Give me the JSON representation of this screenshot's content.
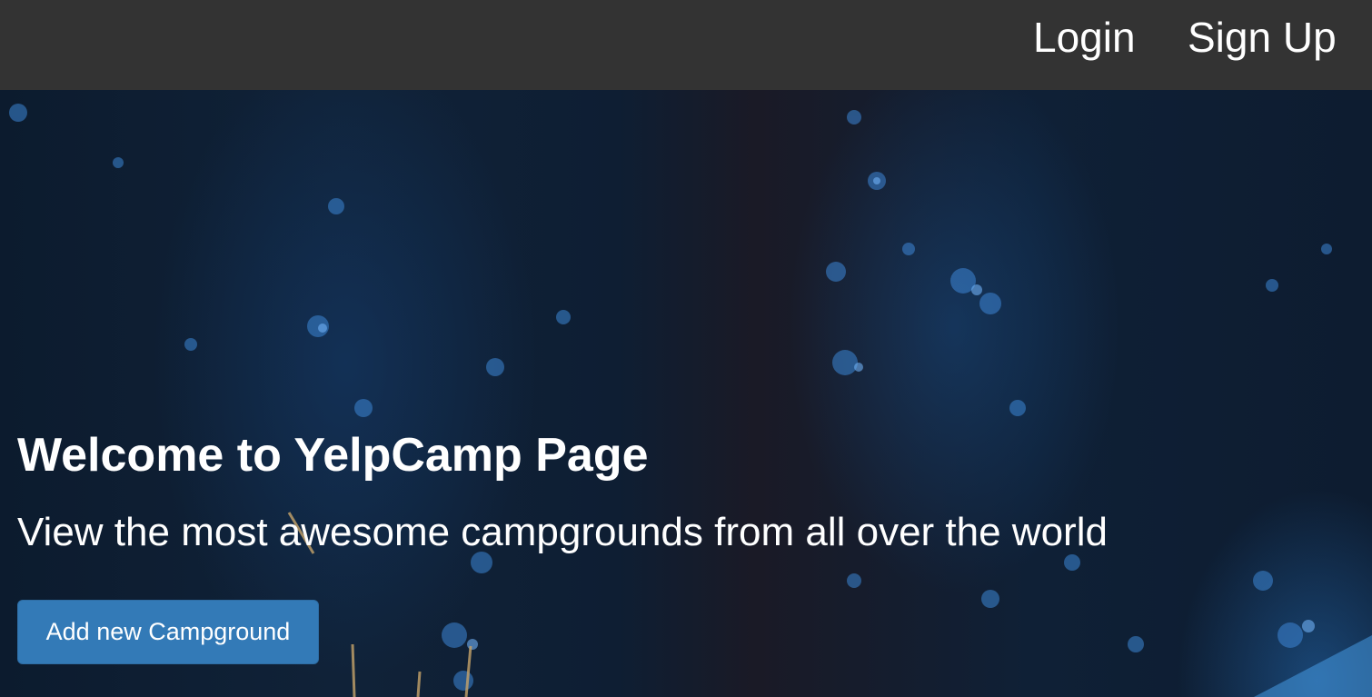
{
  "navbar": {
    "login_label": "Login",
    "signup_label": "Sign Up",
    "background_color": "#333333"
  },
  "hero": {
    "title": "Welcome to YelpCamp Page",
    "subtitle": "View the most awesome campgrounds from all over the world",
    "add_button_label": "Add new Campground",
    "button_color": "#337ab7",
    "background_image": "night-forest-campfire-photo"
  }
}
